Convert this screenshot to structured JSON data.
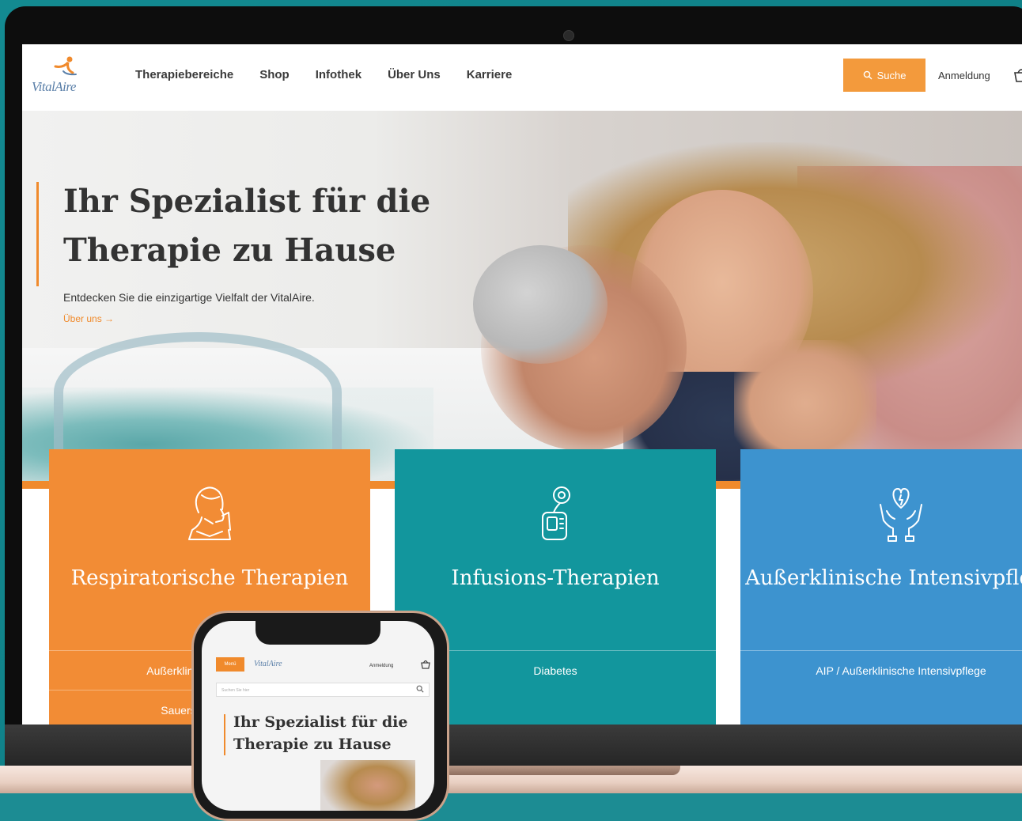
{
  "nav": {
    "logo_text": "VitalAire",
    "links": [
      "Therapiebereiche",
      "Shop",
      "Infothek",
      "Über Uns",
      "Karriere"
    ],
    "search_label": "Suche",
    "login_label": "Anmeldung"
  },
  "hero": {
    "title": "Ihr Spezialist für die Therapie zu Hause",
    "subtitle": "Entdecken Sie die einzigartige Vielfalt der VitalAire.",
    "link_label": "Über uns"
  },
  "cards": [
    {
      "title": "Respiratorische Therapien",
      "icon": "patient-breathing-icon",
      "links": [
        "Außerklinische Beatmung",
        "Sauerstoff-Therapie"
      ],
      "color": "#f28c35"
    },
    {
      "title": "Infusions-Therapien",
      "icon": "infusion-pump-icon",
      "links": [
        "Diabetes"
      ],
      "color": "#12969d"
    },
    {
      "title": "Außerklinische Intensivpflege",
      "icon": "hands-heart-icon",
      "links": [
        "AIP / Außerklinische Intensivpflege"
      ],
      "color": "#3d93cf"
    }
  ],
  "phone": {
    "menu_label": "Menü",
    "logo_text": "VitalAire",
    "login_label": "Anmeldung",
    "search_placeholder": "Suchen Sie hier",
    "title": "Ihr Spezialist für die Therapie zu Hause"
  },
  "colors": {
    "accent_orange": "#f08a2c",
    "teal": "#12969d",
    "blue": "#3d93cf",
    "background": "#138a91"
  }
}
